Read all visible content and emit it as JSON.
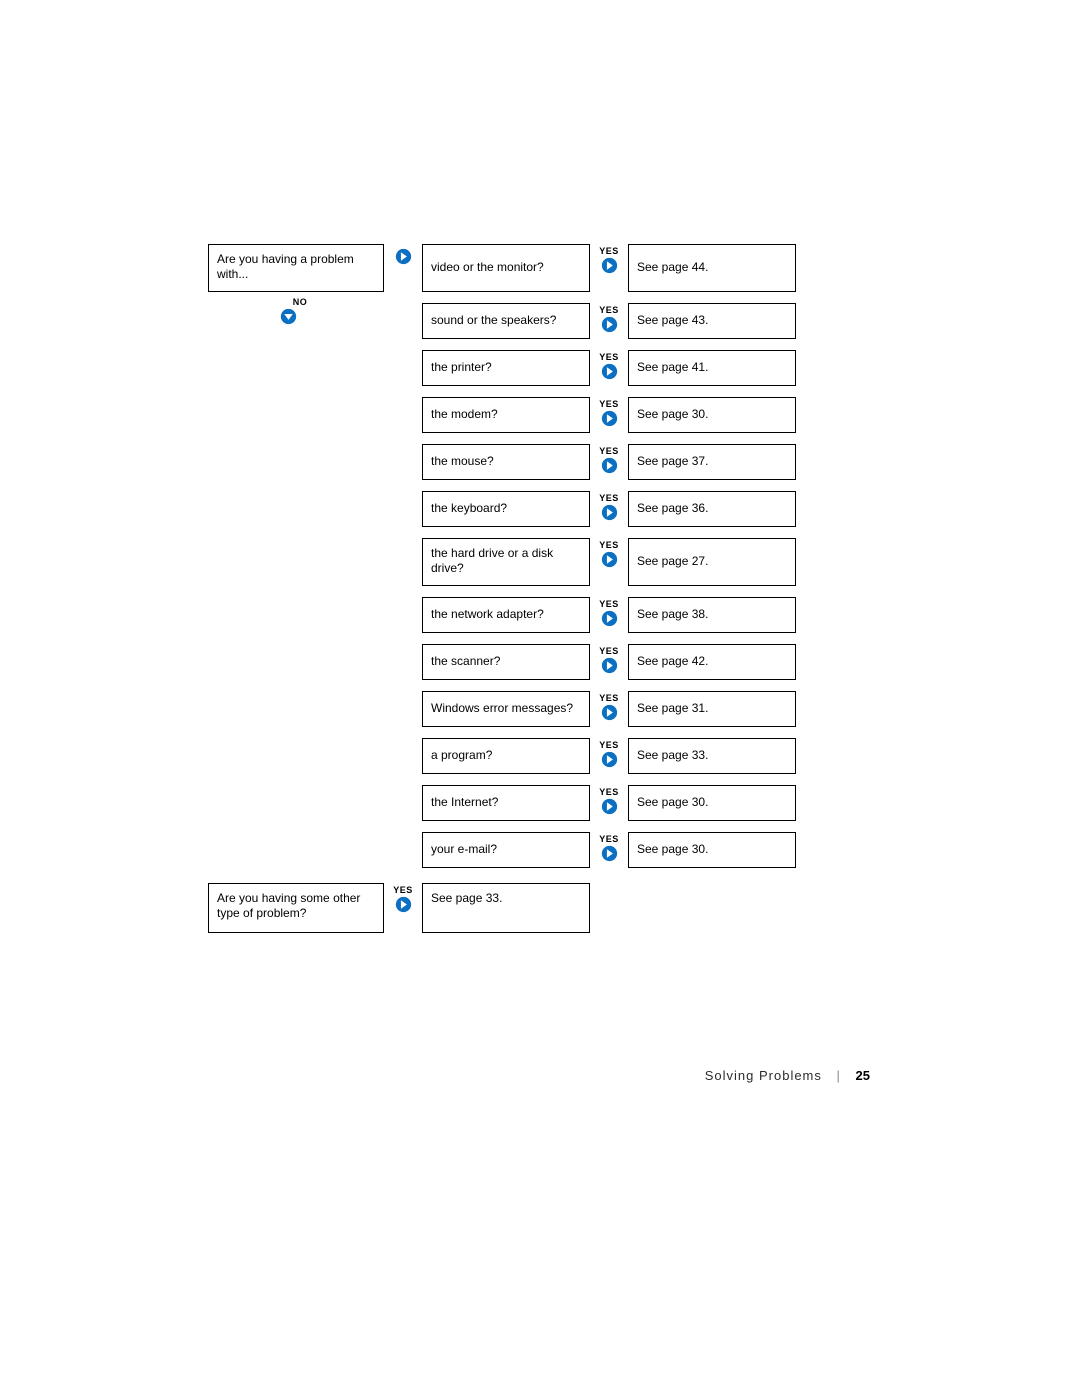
{
  "labels": {
    "yes": "YES",
    "no": "NO",
    "separator": "|"
  },
  "footer": {
    "section": "Solving Problems",
    "pagenum": "25"
  },
  "questionTop": "Are you having a problem with...",
  "items": [
    {
      "question": "video or the monitor?",
      "answer": "See page 44."
    },
    {
      "question": "sound or the speakers?",
      "answer": "See page 43."
    },
    {
      "question": "the printer?",
      "answer": "See page 41."
    },
    {
      "question": "the modem?",
      "answer": "See page 30."
    },
    {
      "question": "the mouse?",
      "answer": "See page 37."
    },
    {
      "question": "the keyboard?",
      "answer": "See page 36."
    },
    {
      "question": "the hard drive or a disk drive?",
      "answer": "See page 27."
    },
    {
      "question": "the network adapter?",
      "answer": "See page 38."
    },
    {
      "question": "the scanner?",
      "answer": "See page 42."
    },
    {
      "question": "Windows error messages?",
      "answer": "See page 31."
    },
    {
      "question": "a program?",
      "answer": "See page 33."
    },
    {
      "question": "the Internet?",
      "answer": "See page 30."
    },
    {
      "question": "your e-mail?",
      "answer": "See page 30."
    }
  ],
  "questionBottom": "Are you having some other type of problem?",
  "answerBottom": "See page 33."
}
